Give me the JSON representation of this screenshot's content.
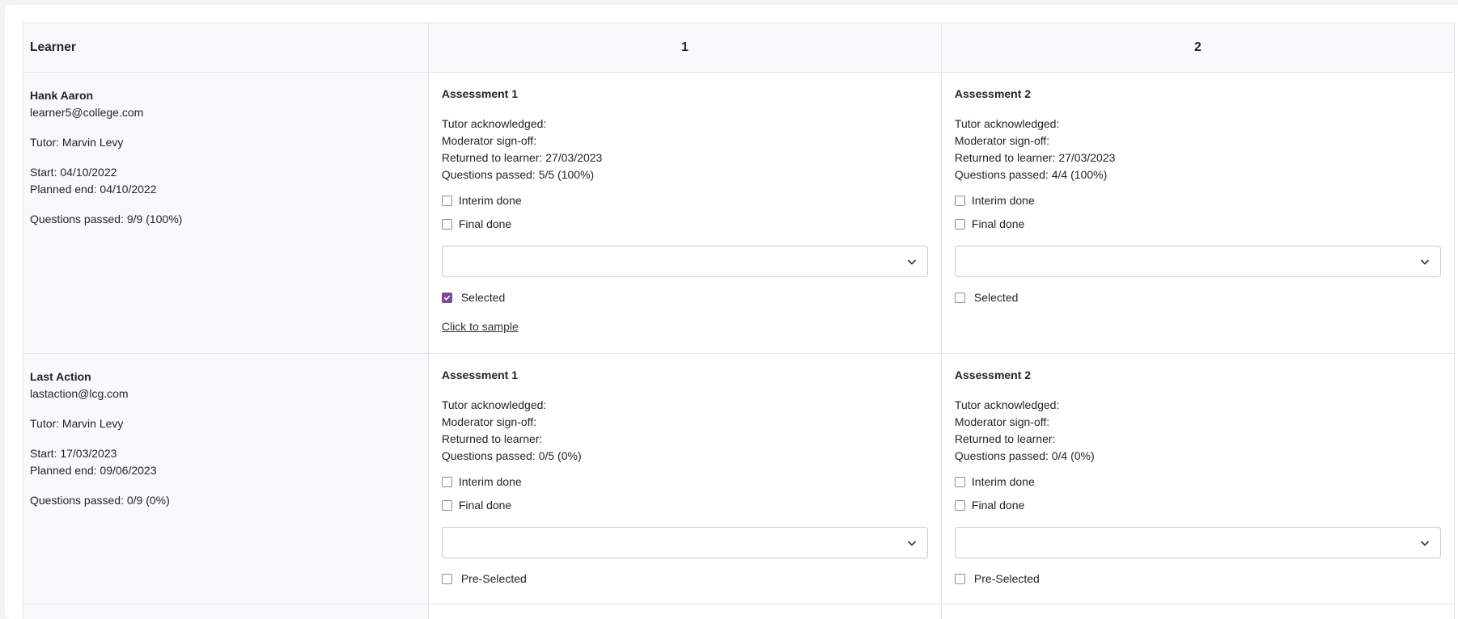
{
  "header": {
    "learner_col": "Learner",
    "col1": "1",
    "col2": "2"
  },
  "labels": {
    "tutor_ack": "Tutor acknowledged:",
    "moderator": "Moderator sign-off:",
    "returned": "Returned to learner:",
    "interim": "Interim done",
    "final": "Final done"
  },
  "rows": [
    {
      "name": "Hank Aaron",
      "email": "learner5@college.com",
      "tutor": "Tutor: Marvin Levy",
      "start": "Start: 04/10/2022",
      "planned_end": "Planned end: 04/10/2022",
      "questions": "Questions passed: 9/9 (100%)",
      "assessments": [
        {
          "title": "Assessment 1",
          "returned_date": "27/03/2023",
          "questions": "Questions passed: 5/5 (100%)",
          "interim_done": false,
          "final_done": false,
          "select_value": "",
          "selected_label": "Selected",
          "selected_checked": true,
          "sample_link": "Click to sample"
        },
        {
          "title": "Assessment 2",
          "returned_date": "27/03/2023",
          "questions": "Questions passed: 4/4 (100%)",
          "interim_done": false,
          "final_done": false,
          "select_value": "",
          "selected_label": "Selected",
          "selected_checked": false
        }
      ]
    },
    {
      "name": "Last Action",
      "email": "lastaction@lcg.com",
      "tutor": "Tutor: Marvin Levy",
      "start": "Start: 17/03/2023",
      "planned_end": "Planned end: 09/06/2023",
      "questions": "Questions passed: 0/9 (0%)",
      "assessments": [
        {
          "title": "Assessment 1",
          "returned_date": "",
          "questions": "Questions passed: 0/5 (0%)",
          "interim_done": false,
          "final_done": false,
          "select_value": "",
          "selected_label": "Pre-Selected",
          "selected_checked": false
        },
        {
          "title": "Assessment 2",
          "returned_date": "",
          "questions": "Questions passed: 0/4 (0%)",
          "interim_done": false,
          "final_done": false,
          "select_value": "",
          "selected_label": "Pre-Selected",
          "selected_checked": false
        }
      ]
    }
  ],
  "colors": {
    "accent": "#7b4b94",
    "header_bg": "#f8f9fa",
    "border": "#e3e5e8"
  }
}
